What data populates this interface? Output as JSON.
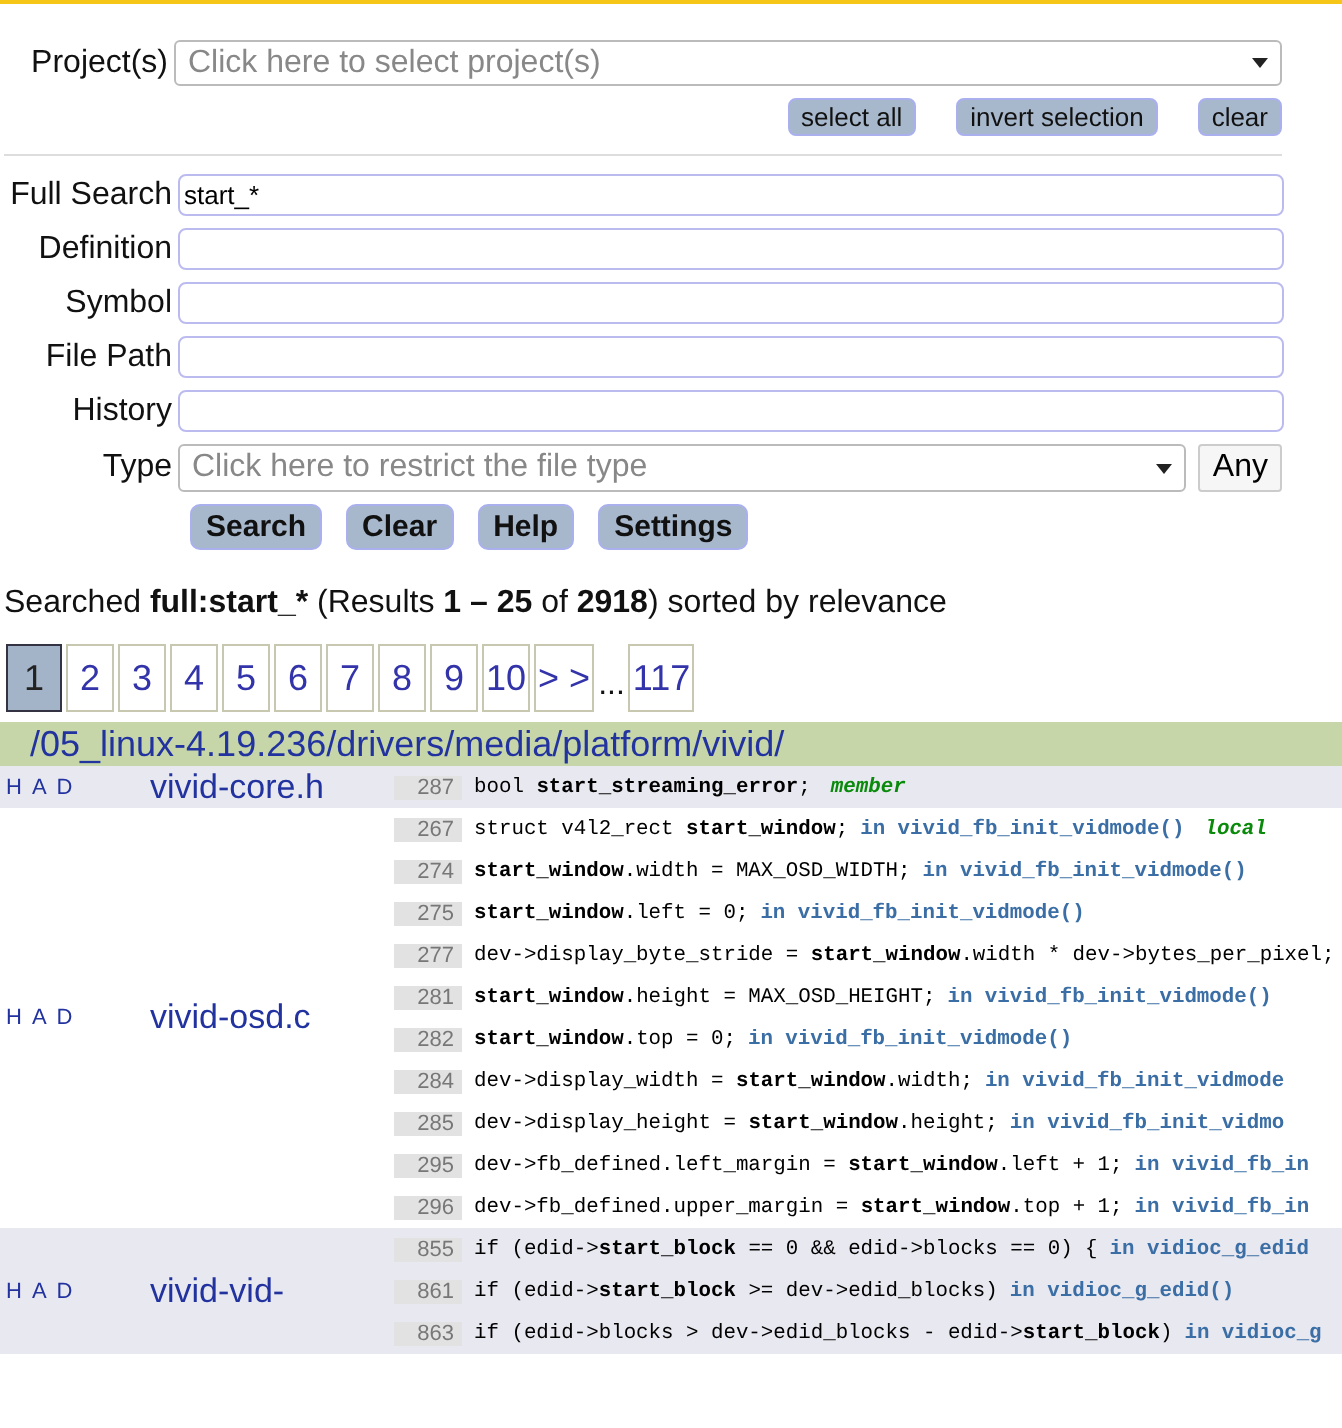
{
  "project": {
    "label": "Project(s)",
    "placeholder": "Click here to select project(s)",
    "buttons": [
      "select all",
      "invert selection",
      "clear"
    ]
  },
  "fields": [
    {
      "label": "Full Search",
      "value": "start_*"
    },
    {
      "label": "Definition"
    },
    {
      "label": "Symbol"
    },
    {
      "label": "File Path"
    },
    {
      "label": "History"
    }
  ],
  "type": {
    "label": "Type",
    "placeholder": "Click here to restrict the file type",
    "button": "Any"
  },
  "actions": [
    "Search",
    "Clear",
    "Help",
    "Settings"
  ],
  "summary": [
    {
      "text": "Searched ",
      "bold": false
    },
    {
      "text": "full:start_*",
      "bold": true
    },
    {
      "text": " (Results ",
      "bold": false
    },
    {
      "text": "1 – 25",
      "bold": true
    },
    {
      "text": " of ",
      "bold": false
    },
    {
      "text": "2918",
      "bold": true
    },
    {
      "text": ") sorted by relevance",
      "bold": false
    }
  ],
  "pages": [
    {
      "label": "1",
      "selected": true
    },
    {
      "label": "2",
      "selected": false
    },
    {
      "label": "3",
      "selected": false
    },
    {
      "label": "4",
      "selected": false
    },
    {
      "label": "5",
      "selected": false
    },
    {
      "label": "6",
      "selected": false
    },
    {
      "label": "7",
      "selected": false
    },
    {
      "label": "8",
      "selected": false
    },
    {
      "label": "9",
      "selected": false
    },
    {
      "label": "10",
      "selected": false
    },
    {
      "label": "> >",
      "selected": false
    }
  ],
  "ellipsis": "...",
  "last_page": "117",
  "directory": "/05_linux-4.19.236/drivers/media/platform/vivid/",
  "files": [
    {
      "links": [
        "H",
        "A",
        "D"
      ],
      "name": "vivid-core.h",
      "lines": [
        {
          "number": "287",
          "code": [
            {
              "text": "bool "
            },
            {
              "text": "start_streaming_error",
              "bold": true
            },
            {
              "text": ";"
            }
          ],
          "tag": "member"
        }
      ]
    },
    {
      "links": [
        "H",
        "A",
        "D"
      ],
      "name": "vivid-osd.c",
      "lines": [
        {
          "number": "267",
          "code": [
            {
              "text": "struct v4l2_rect "
            },
            {
              "text": "start_window",
              "bold": true
            },
            {
              "text": ";"
            }
          ],
          "scope": "in vivid_fb_init_vidmode()",
          "tag": "local"
        },
        {
          "number": "274",
          "code": [
            {
              "text": "start_window",
              "bold": true
            },
            {
              "text": ".width = MAX_OSD_WIDTH;"
            }
          ],
          "scope": "in vivid_fb_init_vidmode()"
        },
        {
          "number": "275",
          "code": [
            {
              "text": "start_window",
              "bold": true
            },
            {
              "text": ".left = 0;"
            }
          ],
          "scope": "in vivid_fb_init_vidmode()"
        },
        {
          "number": "277",
          "code": [
            {
              "text": "dev->display_byte_stride = "
            },
            {
              "text": "start_window",
              "bold": true
            },
            {
              "text": ".width * dev->bytes_per_pixel;"
            }
          ]
        },
        {
          "number": "281",
          "code": [
            {
              "text": "start_window",
              "bold": true
            },
            {
              "text": ".height = MAX_OSD_HEIGHT;"
            }
          ],
          "scope": "in vivid_fb_init_vidmode()"
        },
        {
          "number": "282",
          "code": [
            {
              "text": "start_window",
              "bold": true
            },
            {
              "text": ".top = 0;"
            }
          ],
          "scope": "in vivid_fb_init_vidmode()"
        },
        {
          "number": "284",
          "code": [
            {
              "text": "dev->display_width = "
            },
            {
              "text": "start_window",
              "bold": true
            },
            {
              "text": ".width;"
            }
          ],
          "scope": "in vivid_fb_init_vidmode"
        },
        {
          "number": "285",
          "code": [
            {
              "text": "dev->display_height = "
            },
            {
              "text": "start_window",
              "bold": true
            },
            {
              "text": ".height;"
            }
          ],
          "scope": "in vivid_fb_init_vidmo"
        },
        {
          "number": "295",
          "code": [
            {
              "text": "dev->fb_defined.left_margin = "
            },
            {
              "text": "start_window",
              "bold": true
            },
            {
              "text": ".left + 1;"
            }
          ],
          "scope": "in vivid_fb_in"
        },
        {
          "number": "296",
          "code": [
            {
              "text": "dev->fb_defined.upper_margin = "
            },
            {
              "text": "start_window",
              "bold": true
            },
            {
              "text": ".top + 1;"
            }
          ],
          "scope": "in vivid_fb_in"
        }
      ]
    },
    {
      "links": [
        "H",
        "A",
        "D"
      ],
      "name": "vivid-vid-",
      "lines": [
        {
          "number": "855",
          "code": [
            {
              "text": "if (edid->"
            },
            {
              "text": "start_block",
              "bold": true
            },
            {
              "text": " == 0 && edid->blocks == 0) {"
            }
          ],
          "scope": "in vidioc_g_edid"
        },
        {
          "number": "861",
          "code": [
            {
              "text": "if (edid->"
            },
            {
              "text": "start_block",
              "bold": true
            },
            {
              "text": " >= dev->edid_blocks)"
            }
          ],
          "scope": "in vidioc_g_edid()"
        },
        {
          "number": "863",
          "code": [
            {
              "text": "if (edid->blocks > dev->edid_blocks - edid->"
            },
            {
              "text": "start_block",
              "bold": true
            },
            {
              "text": ")"
            }
          ],
          "scope": "in vidioc_g"
        }
      ]
    }
  ]
}
